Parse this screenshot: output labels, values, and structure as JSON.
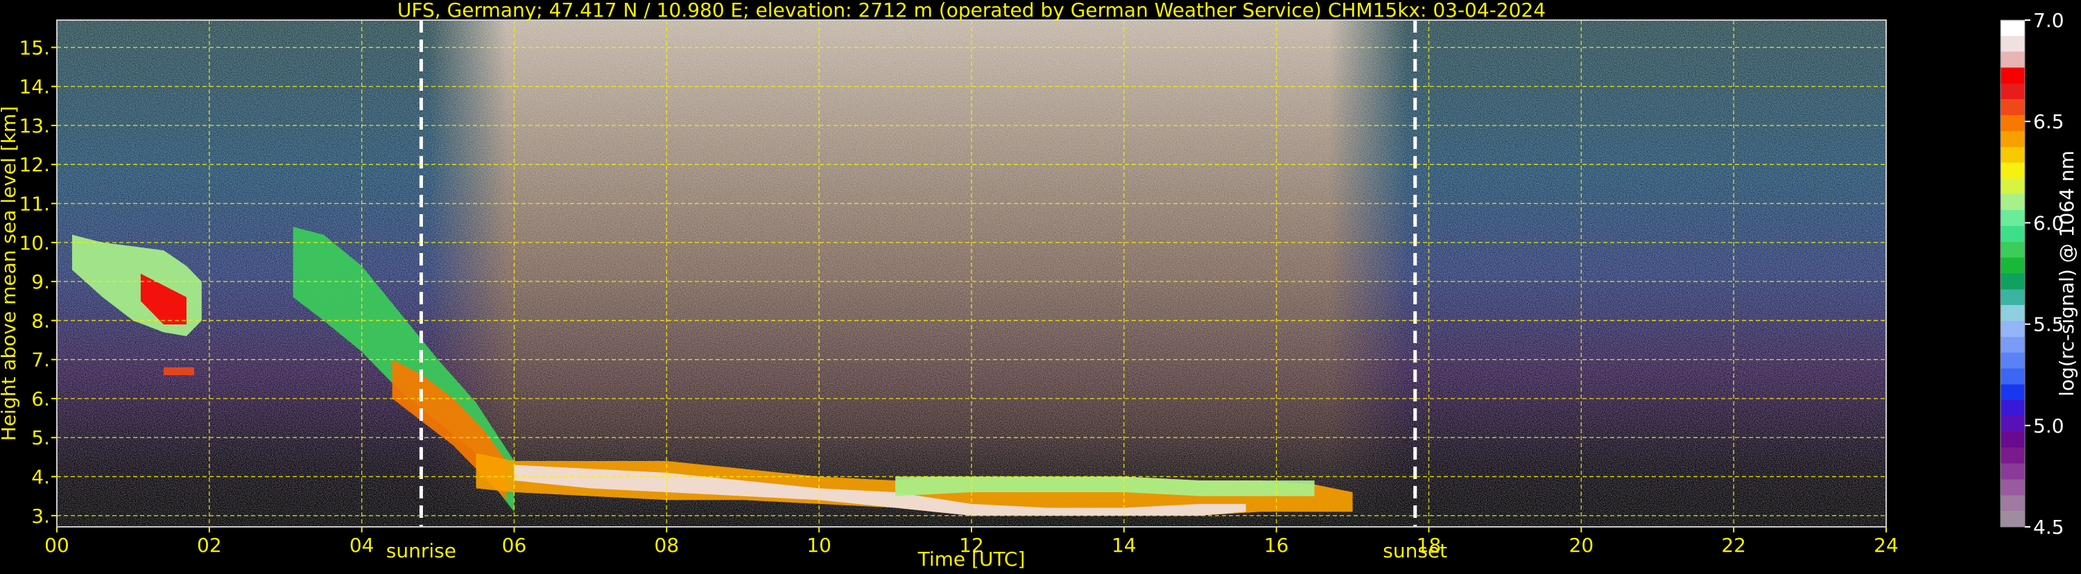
{
  "chart_data": {
    "type": "heatmap",
    "title": "UFS, Germany; 47.417 N / 10.980 E; elevation: 2712 m  (operated by German Weather Service)    CHM15kx: 03-04-2024",
    "xlabel": "Time [UTC]",
    "ylabel": "Height above mean sea level [km]",
    "xlim": [
      0,
      24
    ],
    "ylim": [
      2.712,
      15.7
    ],
    "x_ticks": [
      0,
      2,
      4,
      6,
      8,
      10,
      12,
      14,
      16,
      18,
      20,
      22,
      24
    ],
    "x_tick_labels": [
      "00",
      "02",
      "04",
      "06",
      "08",
      "10",
      "12",
      "14",
      "16",
      "18",
      "20",
      "22",
      "24"
    ],
    "y_ticks": [
      3,
      4,
      5,
      6,
      7,
      8,
      9,
      10,
      11,
      12,
      13,
      14,
      15
    ],
    "y_tick_labels": [
      "3.",
      "4.",
      "5.",
      "6.",
      "7.",
      "8.",
      "9.",
      "10.",
      "11.",
      "12.",
      "13.",
      "14.",
      "15."
    ],
    "grid": true,
    "annotations": [
      {
        "label": "sunrise",
        "x": 4.78
      },
      {
        "label": "sunset",
        "x": 17.82
      }
    ],
    "colorbar": {
      "label": "log(rc-signal) @ 1064 nm",
      "range": [
        4.5,
        7.0
      ],
      "ticks": [
        4.5,
        5.0,
        5.5,
        6.0,
        6.5,
        7.0
      ],
      "tick_labels": [
        "4.5",
        "5.0",
        "5.5",
        "6.0",
        "6.5",
        "7.0"
      ],
      "colors": [
        "#a08ca0",
        "#a07aa0",
        "#9a5aa0",
        "#8a3a98",
        "#7a1a8c",
        "#6a0a90",
        "#5a10b8",
        "#3a18d8",
        "#1838f0",
        "#3c66f4",
        "#5a82f4",
        "#7a9cf6",
        "#96b4f8",
        "#8ecfe0",
        "#3cb4a0",
        "#10a060",
        "#18b838",
        "#3ccc5a",
        "#3ce08a",
        "#6aec9a",
        "#a8f08a",
        "#d8f440",
        "#f8f010",
        "#f8c800",
        "#f8a000",
        "#f87800",
        "#f04818",
        "#e81c1c",
        "#f80000",
        "#e8b4b4",
        "#f0e0e0",
        "#ffffff"
      ]
    },
    "features": [
      {
        "name": "cirrus-early",
        "t": [
          0.2,
          0.6,
          1.0,
          1.4,
          1.7,
          1.9
        ],
        "h_bottom": [
          9.3,
          8.6,
          8.0,
          7.7,
          7.6,
          8.0
        ],
        "h_top": [
          10.2,
          10.0,
          9.9,
          9.8,
          9.4,
          9.0
        ],
        "level": 6.1
      },
      {
        "name": "cirrus-core",
        "t": [
          1.1,
          1.4,
          1.7
        ],
        "h_bottom": [
          8.5,
          7.9,
          7.9
        ],
        "h_top": [
          9.2,
          8.9,
          8.6
        ],
        "level": 6.7
      },
      {
        "name": "cloud-small",
        "t": [
          1.4,
          1.6,
          1.8
        ],
        "h_bottom": [
          6.6,
          6.6,
          6.6
        ],
        "h_top": [
          6.8,
          6.8,
          6.8
        ],
        "level": 6.6
      },
      {
        "name": "descending-layer",
        "t": [
          3.1,
          3.5,
          4.0,
          4.5,
          5.0,
          5.5,
          5.8,
          6.0
        ],
        "h_bottom": [
          8.6,
          8.0,
          7.2,
          6.2,
          5.4,
          4.6,
          3.6,
          3.1
        ],
        "h_top": [
          10.4,
          10.2,
          9.4,
          8.2,
          7.0,
          5.9,
          5.0,
          4.4
        ],
        "level": 5.9
      },
      {
        "name": "descending-core",
        "t": [
          4.4,
          4.8,
          5.2,
          5.6,
          5.9
        ],
        "h_bottom": [
          6.0,
          5.4,
          4.8,
          4.0,
          3.4
        ],
        "h_top": [
          7.0,
          6.6,
          6.0,
          5.2,
          4.4
        ],
        "level": 6.5
      },
      {
        "name": "boundary-layer",
        "t": [
          5.5,
          6.0,
          7.0,
          8.0,
          9.0,
          10.0,
          11.0,
          11.5,
          12.0,
          13.0,
          14.0,
          15.0,
          15.8,
          16.5,
          17.0
        ],
        "h_bottom": [
          3.7,
          3.6,
          3.5,
          3.4,
          3.4,
          3.3,
          3.2,
          3.1,
          3.0,
          3.0,
          3.0,
          3.0,
          3.1,
          3.1,
          3.1
        ],
        "h_top": [
          4.6,
          4.4,
          4.4,
          4.4,
          4.2,
          4.0,
          3.9,
          4.0,
          4.0,
          4.0,
          4.0,
          3.9,
          3.9,
          3.8,
          3.6
        ],
        "level": 6.4
      },
      {
        "name": "boundary-layer-core",
        "t": [
          6.0,
          7.0,
          8.0,
          9.0,
          10.0,
          11.0,
          12.0,
          13.0,
          14.0,
          15.0,
          15.6
        ],
        "h_bottom": [
          3.9,
          3.7,
          3.6,
          3.5,
          3.4,
          3.2,
          3.0,
          3.0,
          3.0,
          3.0,
          3.1
        ],
        "h_top": [
          4.3,
          4.2,
          4.1,
          3.9,
          3.7,
          3.6,
          3.3,
          3.2,
          3.2,
          3.3,
          3.3
        ],
        "level": 6.9
      },
      {
        "name": "afternoon-layer",
        "t": [
          11.0,
          12.0,
          13.0,
          14.0,
          15.0,
          16.0,
          16.5
        ],
        "h_bottom": [
          3.5,
          3.6,
          3.6,
          3.6,
          3.5,
          3.5,
          3.5
        ],
        "h_top": [
          4.0,
          4.0,
          4.0,
          4.0,
          3.9,
          3.9,
          3.9
        ],
        "level": 6.1
      }
    ]
  }
}
